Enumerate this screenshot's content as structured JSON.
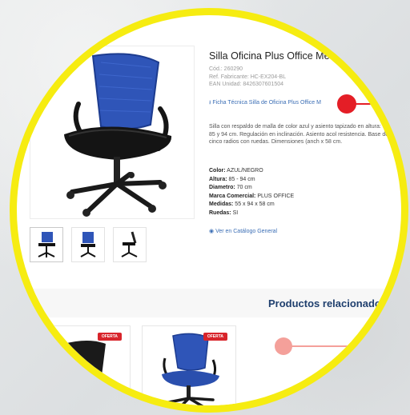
{
  "product": {
    "title": "Silla Oficina Plus Office Me",
    "cod": "Cód.: 260290",
    "ref": "Ref. Fabricante: HC-EX204-BL",
    "ean": "EAN Unidad: 8426307601504",
    "ficha": "Ficha Técnica Silla de Oficina Plus Office M",
    "description": "Silla con respaldo de malla de color azul y asiento tapizado en altura: entre 85 y 94 cm. Regulación en inclinación. Asiento acol resistencia. Base de cinco radios con ruedas. Dimensiones (anch x 58 cm.",
    "specs": [
      {
        "label": "Color:",
        "value": "AZUL/NEGRO"
      },
      {
        "label": "Altura:",
        "value": "85 - 94 cm"
      },
      {
        "label": "Diametro:",
        "value": "70 cm"
      },
      {
        "label": "Marca Comercial:",
        "value": "PLUS OFFICE"
      },
      {
        "label": "Medidas:",
        "value": "55 x 94 x 58 cm"
      },
      {
        "label": "Ruedas:",
        "value": "SI"
      }
    ],
    "catalog": "Ver en Catálogo General"
  },
  "related": {
    "title": "Productos relacionados",
    "badge": "OFERTA"
  },
  "colors": {
    "ring": "#f6ec11",
    "callout_top": "#e41e26",
    "callout_bottom": "#f4a09a",
    "link": "#3b6eb5",
    "heading": "#1f3f6e"
  }
}
